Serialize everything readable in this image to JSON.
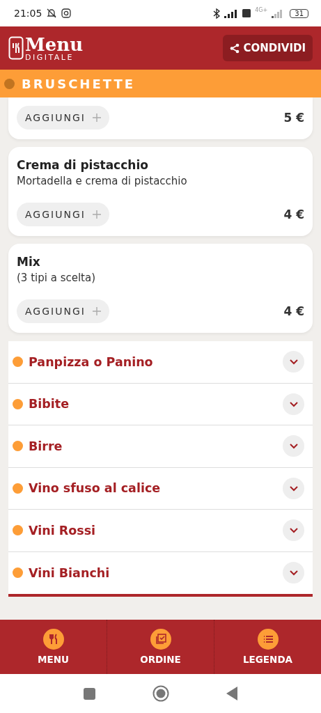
{
  "status_bar": {
    "time": "21:05",
    "network": "4G+",
    "battery": "31"
  },
  "header": {
    "logo_title": "Menu",
    "logo_subtitle": "DIGITALE",
    "share_button": "CONDIVIDI"
  },
  "current_category": {
    "label": "BRUSCHETTE"
  },
  "items": [
    {
      "add_button": "AGGIUNGI",
      "price": "5 €"
    },
    {
      "name": "Crema di pistacchio",
      "description": "Mortadella e crema di pistacchio",
      "add_button": "AGGIUNGI",
      "price": "4 €"
    },
    {
      "name": "Mix",
      "description": "(3 tipi a scelta)",
      "add_button": "AGGIUNGI",
      "price": "4 €"
    }
  ],
  "categories": [
    {
      "label": "Panpizza o Panino",
      "expanded": false
    },
    {
      "label": "Bibite",
      "expanded": false
    },
    {
      "label": "Birre",
      "expanded": false
    },
    {
      "label": "Vino sfuso al calice",
      "expanded": false
    },
    {
      "label": "Vini Rossi",
      "expanded": false
    },
    {
      "label": "Vini Bianchi",
      "expanded": false
    }
  ],
  "bottom_nav": [
    {
      "kind": "menu",
      "label": "MENU"
    },
    {
      "kind": "order",
      "label": "ORDINE"
    },
    {
      "kind": "legend",
      "label": "LEGENDA"
    }
  ]
}
